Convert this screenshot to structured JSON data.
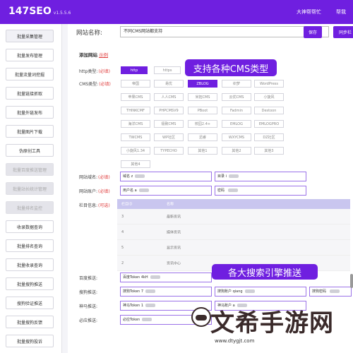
{
  "app": {
    "name": "147SEO",
    "version": "v1.5.5.6"
  },
  "topbar": {
    "link1": "大神帮帮忙",
    "link2": "帮我"
  },
  "sidebar": {
    "items": [
      {
        "label": "批量采集管理",
        "state": "active"
      },
      {
        "label": "批量发布管理",
        "state": "normal"
      },
      {
        "label": "批量流量词挖掘",
        "state": "normal"
      },
      {
        "label": "批量链接抓取",
        "state": "normal"
      },
      {
        "label": "批量外链发布",
        "state": "normal"
      },
      {
        "label": "批量图片下载",
        "state": "normal"
      },
      {
        "label": "伪原创工具",
        "state": "normal"
      },
      {
        "label": "批量百度推送管理",
        "state": "disabled"
      },
      {
        "label": "批量站长统计管理",
        "state": "disabled"
      },
      {
        "label": "批量排名监控",
        "state": "disabled"
      },
      {
        "label": "收录数据查询",
        "state": "normal"
      },
      {
        "label": "批量排名查询",
        "state": "normal"
      },
      {
        "label": "批量收录查询",
        "state": "normal"
      },
      {
        "label": "批量搜狗推送",
        "state": "normal"
      },
      {
        "label": "搜狗验证推送",
        "state": "normal"
      },
      {
        "label": "批量搜狗反馈",
        "state": "normal"
      },
      {
        "label": "批量搜狗投诉",
        "state": "normal"
      }
    ]
  },
  "header": {
    "site_label": "网站名称:",
    "site_value": "不同CMS网站都支持",
    "save_label": "保存",
    "sync_label": "同步栏"
  },
  "add_site": {
    "title": "添加网站",
    "example": "示例"
  },
  "labels": {
    "http": "http类型:",
    "cms": "CMS类型:",
    "domain": "网站域名:",
    "account": "网站账户:",
    "column": "栏目信息:",
    "baidu": "百度推送:",
    "sogou": "搜狗推送:",
    "shenma": "神马推送:",
    "bing": "必应推送:",
    "required": "(必填)",
    "optional": "(可选)"
  },
  "http_options": [
    "http",
    "https"
  ],
  "cms_options": [
    [
      "帝国",
      "易优",
      "ZBLOG",
      "织梦",
      "WordPress"
    ],
    [
      "苹果CMS",
      "人人CMS",
      "米拓CMS",
      "云优CMS",
      "小旋风"
    ],
    [
      "THINKCMF",
      "PHPCMSV9",
      "PBoot",
      "Fadmin",
      "Destoon"
    ],
    [
      "海洋CMS",
      "极致CMS",
      "校园2.4+",
      "EMLOG",
      "EMLOGPRO"
    ],
    [
      "TWCMS",
      "WP社区",
      "迅睿",
      "WXYCMS",
      "DZ社区"
    ],
    [
      "小旋风1.34",
      "TYPECHO",
      "其他1",
      "其他2",
      "其他3"
    ],
    [
      "其他4"
    ]
  ],
  "banners": {
    "cms": "支持各种CMS类型",
    "push": "各大搜索引擎推送"
  },
  "inputs": {
    "domain": "域名 z",
    "directory": "目录 i",
    "username": "用户名 a",
    "password": "密码 "
  },
  "table": {
    "headers": [
      "栏目ID",
      "名称"
    ],
    "rows": [
      {
        "id": "3",
        "name": "最新资讯"
      },
      {
        "id": "4",
        "name": "媒体资讯"
      },
      {
        "id": "5",
        "name": "显示资讯"
      },
      {
        "id": "2",
        "name": "资讯中心"
      }
    ]
  },
  "push": {
    "baidu_token": "百度Token 4kH",
    "sogou_account": "搜狗Token 7",
    "sogou_user": "搜狗账户 qiang",
    "sogou_pass": "搜狗密码 ",
    "shenma_token": "神马Token 1",
    "shenma_user": "神马账户 a",
    "bing_token": "必应Token"
  },
  "watermark": {
    "text": "文希手游网",
    "url": "www.dtygjt.com"
  }
}
